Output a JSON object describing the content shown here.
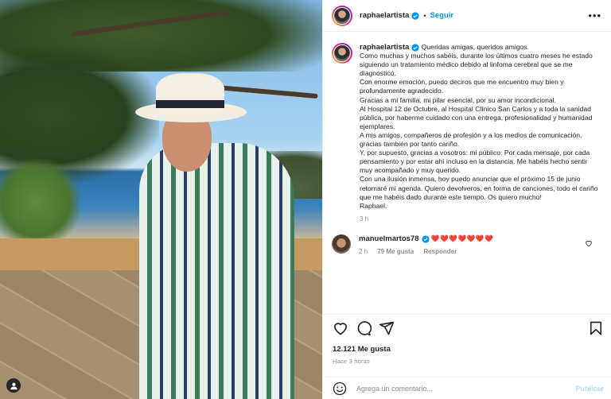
{
  "post": {
    "username": "raphaelartista",
    "follow_label": "Seguir",
    "more_label": "•••",
    "caption": "Queridas amigas, queridos amigos.\nComo muchas y muchos sabéis, durante los últimos cuatro meses he estado siguiendo un tratamiento médico debido al linfoma cerebral que se me diagnosticó.\nCon enorme emoción, puedo deciros que me encuentro muy bien y profundamente agradecido.\nGracias a mi familia, mi pilar esencial, por su amor incondicional.\nAl Hospital 12 de Octubre, al Hospital Clínico San Carlos y a toda la sanidad pública, por haberme cuidado con una entrega, profesionalidad y humanidad ejemplares.\nA mis amigos, compañeros de profesión y a los medios de comunicación, gracias también por tanto cariño.\nY, por supuesto, gracias a vosotros: mi público. Por cada mensaje, por cada pensamiento y por estar ahí incluso en la distancia. Me habéis hecho sentir muy acompañado y muy querido.\nCon una ilusión inmensa, hoy puedo anunciar que el próximo 15 de junio retomaré mi agenda. Quiero devolveros, en forma de canciones, todo el cariño que me habéis dado durante este tiempo. Os quiero mucho!\nRaphael.",
    "caption_time": "3 h",
    "likes": "12.121 Me gusta",
    "posted_ago": "Hace 3 horas"
  },
  "comment": {
    "username": "manuelmartos78",
    "hearts": "❤️❤️❤️❤️❤️❤️❤️",
    "time": "2 h",
    "likes": "79 Me gusta",
    "reply_label": "Responder"
  },
  "composer": {
    "placeholder": "Agrega un comentario...",
    "publish_label": "Publicar"
  },
  "colors": {
    "accent": "#0095f6",
    "heart": "#e0245e",
    "muted": "#8e8e8e"
  },
  "icons": [
    "verified-icon",
    "more-icon",
    "heart-icon",
    "comment-icon",
    "share-icon",
    "save-icon",
    "emoji-icon",
    "user-tag-icon"
  ]
}
